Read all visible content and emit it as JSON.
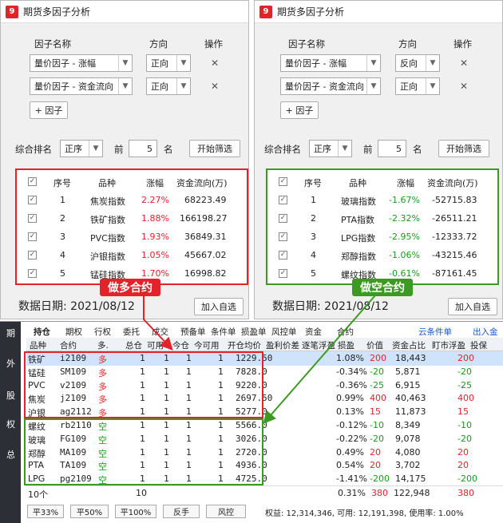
{
  "left_window": {
    "title": "期货多因子分析",
    "col_factor": "因子名称",
    "col_direction": "方向",
    "col_action": "操作",
    "factors": [
      {
        "name": "量价因子 - 涨幅",
        "direction": "正向"
      },
      {
        "name": "量价因子 - 资金流向",
        "direction": "正向"
      }
    ],
    "add_factor": "+ 因子",
    "rank_label": "综合排名",
    "rank_order": "正序",
    "top_label": "前",
    "top_n": "5",
    "unit": "名",
    "start_btn": "开始筛选",
    "table_headers": [
      "序号",
      "品种",
      "涨幅",
      "资金流向(万)"
    ],
    "rows": [
      {
        "idx": "1",
        "name": "焦炭指数",
        "chg": "2.27%",
        "flow": "68223.49"
      },
      {
        "idx": "2",
        "name": "铁矿指数",
        "chg": "1.88%",
        "flow": "166198.27"
      },
      {
        "idx": "3",
        "name": "PVC指数",
        "chg": "1.93%",
        "flow": "36849.31"
      },
      {
        "idx": "4",
        "name": "沪银指数",
        "chg": "1.05%",
        "flow": "45667.02"
      },
      {
        "idx": "5",
        "name": "锰硅指数",
        "chg": "1.70%",
        "flow": "16998.82"
      }
    ],
    "date": "数据日期: 2021/08/12",
    "add_watch": "加入自选",
    "callout": "做多合约"
  },
  "right_window": {
    "title": "期货多因子分析",
    "col_factor": "因子名称",
    "col_direction": "方向",
    "col_action": "操作",
    "factors": [
      {
        "name": "量价因子 - 涨幅",
        "direction": "反向"
      },
      {
        "name": "量价因子 - 资金流向",
        "direction": "正向"
      }
    ],
    "add_factor": "+ 因子",
    "rank_label": "综合排名",
    "rank_order": "正序",
    "top_label": "前",
    "top_n": "5",
    "unit": "名",
    "start_btn": "开始筛选",
    "table_headers": [
      "序号",
      "品种",
      "涨幅",
      "资金流向(万)"
    ],
    "rows": [
      {
        "idx": "1",
        "name": "玻璃指数",
        "chg": "-1.67%",
        "flow": "-52715.83"
      },
      {
        "idx": "2",
        "name": "PTA指数",
        "chg": "-2.32%",
        "flow": "-26511.21"
      },
      {
        "idx": "3",
        "name": "LPG指数",
        "chg": "-2.95%",
        "flow": "-12333.72"
      },
      {
        "idx": "4",
        "name": "郑醇指数",
        "chg": "-1.06%",
        "flow": "-43215.46"
      },
      {
        "idx": "5",
        "name": "螺纹指数",
        "chg": "-0.61%",
        "flow": "-87161.45"
      }
    ],
    "date": "数据日期: 2021/08/12",
    "add_watch": "加入自选",
    "callout": "做空合约"
  },
  "bottom": {
    "sidebar": [
      "期",
      "外",
      "股",
      "权",
      "总"
    ],
    "tabs": [
      "持仓",
      "期权",
      "行权",
      "委托",
      "成交",
      "预备单",
      "条件单",
      "损盈单",
      "风控单",
      "资金",
      "合约"
    ],
    "cloud": "云条件单",
    "deposit": "出入金",
    "headers": [
      "品种",
      "合约",
      "多.",
      "总仓",
      "可用",
      "今仓",
      "今可用",
      "开仓均价",
      "盈利价差",
      "逐笔浮盈",
      "损盈",
      "价值",
      "资金占比",
      "盯市浮盈",
      "投保"
    ],
    "rows": [
      {
        "n": "铁矿",
        "c": "i2109",
        "d": "多",
        "t": "1",
        "a": "1",
        "tt": "1",
        "ta": "1",
        "p": "1229.50",
        "pct": "1.08%",
        "v": "200",
        "val": "18,443",
        "mk": "200"
      },
      {
        "n": "锰硅",
        "c": "SM109",
        "d": "多",
        "t": "1",
        "a": "1",
        "tt": "1",
        "ta": "1",
        "p": "7828.0",
        "pct": "-0.34%",
        "v": "-20",
        "val": "5,871",
        "mk": "-20"
      },
      {
        "n": "PVC",
        "c": "v2109",
        "d": "多",
        "t": "1",
        "a": "1",
        "tt": "1",
        "ta": "1",
        "p": "9220.0",
        "pct": "-0.36%",
        "v": "-25",
        "val": "6,915",
        "mk": "-25"
      },
      {
        "n": "焦炭",
        "c": "j2109",
        "d": "多",
        "t": "1",
        "a": "1",
        "tt": "1",
        "ta": "1",
        "p": "2697.50",
        "pct": "0.99%",
        "v": "400",
        "val": "40,463",
        "mk": "400"
      },
      {
        "n": "沪银",
        "c": "ag2112",
        "d": "多",
        "t": "1",
        "a": "1",
        "tt": "1",
        "ta": "1",
        "p": "5277.0",
        "pct": "0.13%",
        "v": "15",
        "val": "11,873",
        "mk": "15"
      },
      {
        "n": "螺纹",
        "c": "rb2110",
        "d": "空",
        "t": "1",
        "a": "1",
        "tt": "1",
        "ta": "1",
        "p": "5566.0",
        "pct": "-0.12%",
        "v": "-10",
        "val": "8,349",
        "mk": "-10"
      },
      {
        "n": "玻璃",
        "c": "FG109",
        "d": "空",
        "t": "1",
        "a": "1",
        "tt": "1",
        "ta": "1",
        "p": "3026.0",
        "pct": "-0.22%",
        "v": "-20",
        "val": "9,078",
        "mk": "-20"
      },
      {
        "n": "郑醇",
        "c": "MA109",
        "d": "空",
        "t": "1",
        "a": "1",
        "tt": "1",
        "ta": "1",
        "p": "2720.0",
        "pct": "0.49%",
        "v": "20",
        "val": "4,080",
        "mk": "20"
      },
      {
        "n": "PTA",
        "c": "TA109",
        "d": "空",
        "t": "1",
        "a": "1",
        "tt": "1",
        "ta": "1",
        "p": "4936.0",
        "pct": "0.54%",
        "v": "20",
        "val": "3,702",
        "mk": "20"
      },
      {
        "n": "LPG",
        "c": "pg2109",
        "d": "空",
        "t": "1",
        "a": "1",
        "tt": "1",
        "ta": "1",
        "p": "4725.0",
        "pct": "-1.41%",
        "v": "-200",
        "val": "14,175",
        "mk": "-200"
      }
    ],
    "total_label": "10个",
    "total_count": "10",
    "total_pct": "0.31%",
    "total_v": "380",
    "total_val": "122,948",
    "total_mk": "380",
    "buttons": [
      "平33%",
      "平50%",
      "平100%",
      "反手",
      "风控"
    ],
    "account": "权益: 12,314,346, 可用: 12,191,398, 使用率: 1.00%"
  },
  "colors": {
    "red": "#e3222a",
    "green": "#3c9a22"
  }
}
